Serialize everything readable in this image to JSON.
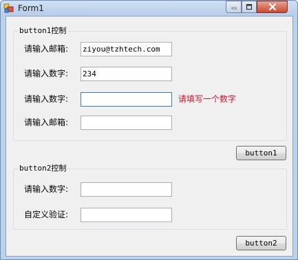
{
  "window": {
    "title": "Form1"
  },
  "titlebar_icons": {
    "app": "form-app-icon",
    "minimize": "minimize-icon",
    "maximize": "maximize-icon",
    "close": "close-icon"
  },
  "group1": {
    "title": "button1控制",
    "rows": [
      {
        "label": "请输入邮箱:",
        "value": "ziyou@tzhtech.com",
        "placeholder": ""
      },
      {
        "label": "请输入数字:",
        "value": "234",
        "placeholder": ""
      },
      {
        "label": "请输入数字:",
        "value": "",
        "placeholder": "",
        "error": "请填写一个数字"
      },
      {
        "label": "请输入邮箱:",
        "value": "",
        "placeholder": ""
      }
    ]
  },
  "button1": {
    "label": "button1"
  },
  "group2": {
    "title": "button2控制",
    "rows": [
      {
        "label": "请输入数字:",
        "value": "",
        "placeholder": ""
      },
      {
        "label": "自定义验证:",
        "value": "",
        "placeholder": ""
      }
    ]
  },
  "button2": {
    "label": "button2"
  },
  "colors": {
    "error_text": "#d0142c",
    "client_bg": "#f0f0f0",
    "titlebar": "#b9d1ea"
  }
}
